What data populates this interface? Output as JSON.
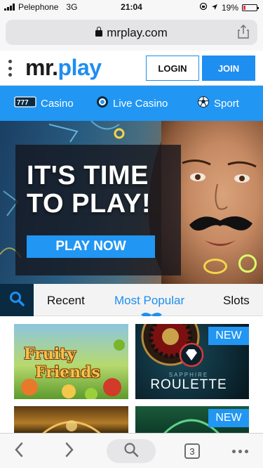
{
  "status_bar": {
    "carrier": "Pelephone",
    "network": "3G",
    "time": "21:04",
    "battery": "19%",
    "battery_level": 0.19
  },
  "browser": {
    "url": "mrplay.com"
  },
  "header": {
    "logo_part1": "mr.",
    "logo_part2": "play",
    "login_label": "LOGIN",
    "join_label": "JOIN"
  },
  "category_nav": {
    "items": [
      {
        "label": "Casino",
        "icon": "slot-777-icon"
      },
      {
        "label": "Live Casino",
        "icon": "live-icon"
      },
      {
        "label": "Sport",
        "icon": "football-icon"
      }
    ]
  },
  "hero": {
    "headline": "IT'S TIME\nTO PLAY!",
    "cta_label": "PLAY NOW"
  },
  "game_tabs": {
    "items": [
      {
        "label": "Recent"
      },
      {
        "label": "Most Popular"
      },
      {
        "label": "Slots"
      }
    ],
    "active": "Most Popular"
  },
  "games": [
    {
      "title_line1": "Fruity",
      "title_line2": "Friends",
      "badge": ""
    },
    {
      "title_line1": "SAPPHIRE",
      "title_line2": "ROULETTE",
      "badge": "NEW"
    },
    {
      "title_line1": "",
      "title_line2": "",
      "badge": ""
    },
    {
      "title_line1": "",
      "title_line2": "",
      "badge": "NEW"
    }
  ],
  "colors": {
    "brand_blue": "#1e8ef0",
    "nav_blue": "#2196f3",
    "dark_navy": "#0a2a42",
    "battery_low": "#e53935"
  }
}
